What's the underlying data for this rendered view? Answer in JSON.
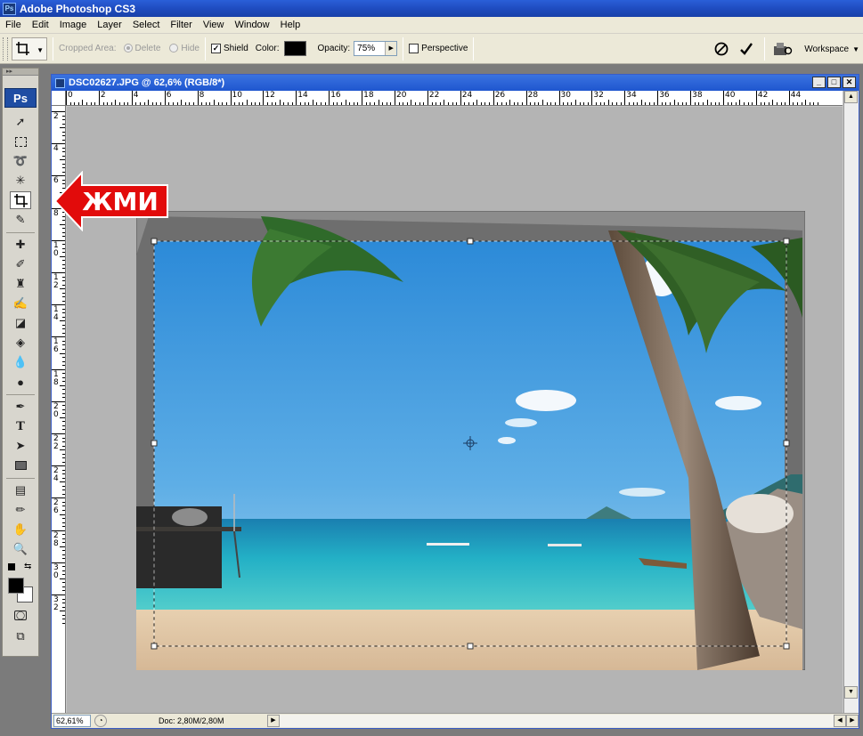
{
  "app": {
    "title": "Adobe Photoshop CS3",
    "icon": "Ps"
  },
  "menu": [
    "File",
    "Edit",
    "Image",
    "Layer",
    "Select",
    "Filter",
    "View",
    "Window",
    "Help"
  ],
  "options": {
    "cropped_area_label": "Cropped Area:",
    "delete_label": "Delete",
    "hide_label": "Hide",
    "shield_label": "Shield",
    "color_label": "Color:",
    "opacity_label": "Opacity:",
    "opacity_value": "75%",
    "perspective_label": "Perspective",
    "workspace_label": "Workspace",
    "shield_checked": true,
    "perspective_checked": false,
    "shield_color": "#000000"
  },
  "toolbox": {
    "logo": "Ps",
    "active_tool": "crop-tool"
  },
  "annotation": {
    "text": "ЖМИ",
    "color": "#e60000"
  },
  "document": {
    "title": "DSC02627.JPG @ 62,6% (RGB/8*)",
    "zoom": "62,61%",
    "doc_info": "Doc: 2,80M/2,80M",
    "ruler_h": [
      "0",
      "2",
      "4",
      "6",
      "8",
      "10",
      "12",
      "14",
      "16",
      "18",
      "20",
      "22",
      "24",
      "26",
      "28",
      "30",
      "32",
      "34",
      "36",
      "38",
      "40",
      "42",
      "44"
    ],
    "ruler_v": [
      "2",
      "4",
      "6",
      "8",
      "1\n0",
      "1\n2",
      "1\n4",
      "1\n6",
      "1\n8",
      "2\n0",
      "2\n2",
      "2\n4",
      "2\n6",
      "2\n8",
      "3\n0",
      "3\n2"
    ]
  }
}
